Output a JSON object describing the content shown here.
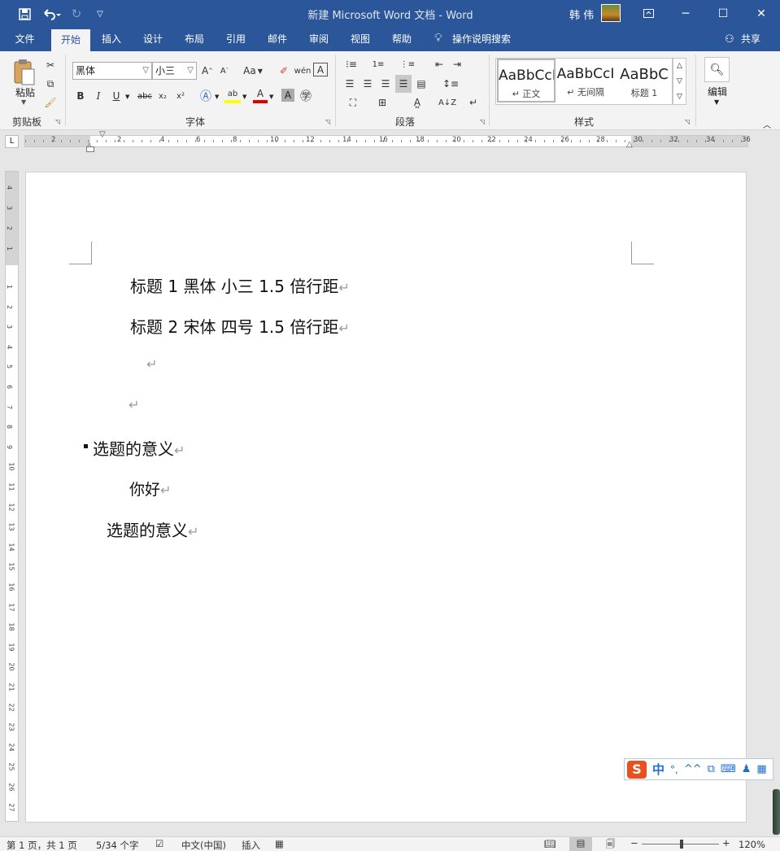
{
  "window": {
    "title": "新建 Microsoft Word 文档 - Word",
    "user": "韩 伟"
  },
  "tabs": [
    "文件",
    "开始",
    "插入",
    "设计",
    "布局",
    "引用",
    "邮件",
    "审阅",
    "视图",
    "帮助"
  ],
  "tell_me": "操作说明搜索",
  "share": "共享",
  "ribbon": {
    "clipboard": {
      "paste": "粘贴",
      "label": "剪贴板"
    },
    "font": {
      "name": "黑体",
      "size": "小三",
      "label": "字体",
      "change_case": "Aa"
    },
    "paragraph": {
      "label": "段落"
    },
    "styles": {
      "label": "样式",
      "items": [
        {
          "preview": "AaBbCcI",
          "name": "正文"
        },
        {
          "preview": "AaBbCcI",
          "name": "无间隔"
        },
        {
          "preview": "AaBbC",
          "name": "标题 1"
        }
      ]
    },
    "editing": {
      "label": "编辑"
    }
  },
  "ruler": {
    "h_ticks": [
      "2",
      "2",
      "4",
      "6",
      "8",
      "10",
      "12",
      "14",
      "16",
      "18",
      "20",
      "22",
      "24",
      "26",
      "28",
      "30",
      "32",
      "34",
      "36"
    ],
    "v_top": [
      "4",
      "3",
      "2",
      "1"
    ],
    "v_ticks": [
      "1",
      "2",
      "3",
      "4",
      "5",
      "6",
      "7",
      "8",
      "9",
      "10",
      "11",
      "12",
      "13",
      "14",
      "15",
      "16",
      "17",
      "18",
      "19",
      "20",
      "21",
      "22",
      "23",
      "24",
      "25",
      "26",
      "27"
    ]
  },
  "document": {
    "line1": "标题 1  黑体  小三  1.5 倍行距",
    "line2": "标题  2  宋体    四号  1.5 倍行距",
    "line5": "选题的意义",
    "line6": "你好",
    "line7": "选题的意义",
    "para_mark": "↵"
  },
  "ime": {
    "mode": "中",
    "punct": "°,"
  },
  "status": {
    "page": "第 1 页，共 1 页",
    "words": "5/34 个字",
    "language": "中文(中国)",
    "mode": "插入",
    "zoom": "120%"
  },
  "colors": {
    "accent": "#2b579a",
    "font_color_bar": "#e00000",
    "highlight_bar": "#ffff00"
  }
}
